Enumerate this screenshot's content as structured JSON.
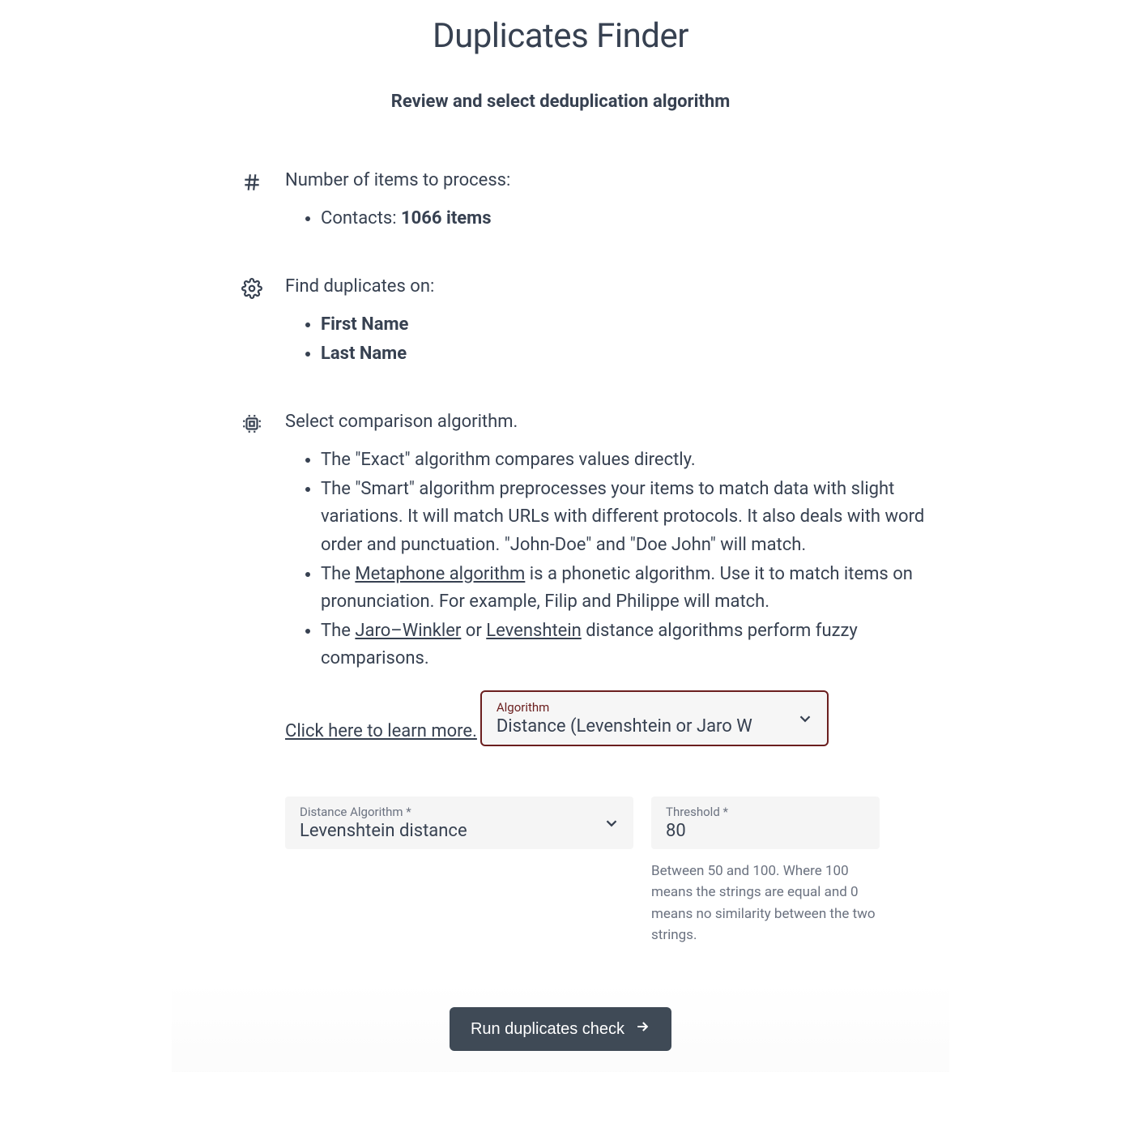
{
  "title": "Duplicates Finder",
  "subtitle": "Review and select deduplication algorithm",
  "sections": {
    "items": {
      "heading": "Number of items to process:",
      "entries": [
        {
          "prefix": "Contacts: ",
          "bold": "1066 items"
        }
      ]
    },
    "fields": {
      "heading": "Find duplicates on:",
      "entries": [
        "First Name",
        "Last Name"
      ]
    },
    "algorithm": {
      "heading": "Select comparison algorithm.",
      "bullets": {
        "exact": "The \"Exact\" algorithm compares values directly.",
        "smart": "The \"Smart\" algorithm preprocesses your items to match data with slight variations. It will match URLs with different protocols. It also deals with word order and punctuation. \"John-Doe\" and \"Doe John\" will match.",
        "metaphone_pre": "The ",
        "metaphone_link": "Metaphone algorithm",
        "metaphone_post": " is a phonetic algorithm. Use it to match items on pronunciation. For example, Filip and Philippe will match.",
        "distance_pre": "The ",
        "distance_link1": "Jaro–Winkler",
        "distance_or": " or ",
        "distance_link2": "Levenshtein",
        "distance_post": " distance algorithms perform fuzzy comparisons."
      },
      "learn_more": "Click here to learn more."
    }
  },
  "form": {
    "algorithm_select": {
      "label": "Algorithm",
      "value": "Distance (Levenshtein or Jaro W"
    },
    "distance_select": {
      "label": "Distance Algorithm *",
      "value": "Levenshtein distance"
    },
    "threshold": {
      "label": "Threshold *",
      "value": "80",
      "helper": "Between 50 and 100. Where 100 means the strings are equal and 0 means no similarity between the two strings."
    }
  },
  "actions": {
    "run": "Run duplicates check"
  }
}
